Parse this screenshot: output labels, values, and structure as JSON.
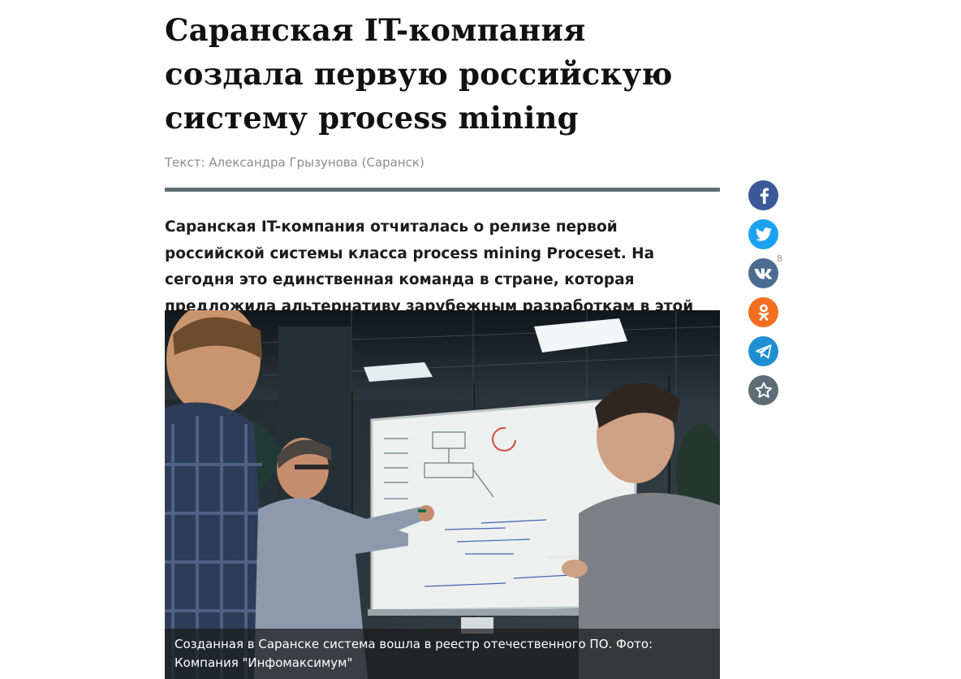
{
  "article": {
    "title": "Саранская IT-компания создала первую российскую систему process mining",
    "byline": "Текст: Александра Грызунова (Саранск)",
    "lead": "Саранская IT-компания отчиталась о релизе первой российской системы класса process mining Proceset. На сегодня это единственная команда в стране, которая предложила альтернативу зарубежным разработкам в этой сфере.",
    "photo": {
      "caption": "Созданная в Саранске система вошла в реестр отечественного ПО. Фото: Компания \"Инфомаксимум\""
    }
  },
  "share": {
    "items": [
      {
        "name": "facebook",
        "icon": "facebook-icon"
      },
      {
        "name": "twitter",
        "icon": "twitter-icon"
      },
      {
        "name": "vk",
        "icon": "vk-icon",
        "count": "8"
      },
      {
        "name": "odnoklassniki",
        "icon": "odnoklassniki-icon"
      },
      {
        "name": "telegram",
        "icon": "telegram-icon"
      },
      {
        "name": "favorite",
        "icon": "star-icon"
      }
    ]
  },
  "colors": {
    "divider": "#5f6f77",
    "facebook": "#3b5998",
    "twitter": "#1da1f2",
    "vk": "#4c6c91",
    "odnoklassniki": "#f36f1f",
    "telegram": "#1e8fd0",
    "favorite": "#5d6d75"
  }
}
